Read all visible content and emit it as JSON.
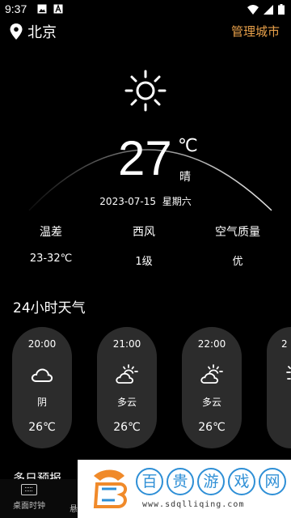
{
  "status_bar": {
    "time": "9:37"
  },
  "header": {
    "city": "北京",
    "manage_label": "管理城市"
  },
  "current": {
    "temperature": "27",
    "unit": "℃",
    "condition": "晴",
    "date": "2023-07-15",
    "weekday": "星期六",
    "icon": "sun-icon"
  },
  "stats": [
    {
      "label": "温差",
      "value": "23-32℃"
    },
    {
      "label": "西风",
      "value": "1级"
    },
    {
      "label": "空气质量",
      "value": "优"
    }
  ],
  "hourly": {
    "title": "24小时天气",
    "items": [
      {
        "time": "20:00",
        "icon": "cloud-icon",
        "condition": "阴",
        "temp": "26℃"
      },
      {
        "time": "21:00",
        "icon": "partly-cloudy-icon",
        "condition": "多云",
        "temp": "26℃"
      },
      {
        "time": "22:00",
        "icon": "partly-cloudy-icon",
        "condition": "多云",
        "temp": "26℃"
      },
      {
        "time": "2",
        "icon": "partly-cloudy-icon",
        "condition": "",
        "temp": ""
      }
    ]
  },
  "multi_day": {
    "title": "多日预报"
  },
  "bottom_nav": {
    "desk_clock": "桌面时钟",
    "next": "悬"
  },
  "watermark": {
    "chars": [
      "百",
      "贵",
      "游",
      "戏",
      "网"
    ],
    "url": "www.sdqlliqing.com"
  },
  "colors": {
    "accent": "#e8a04a",
    "card": "#2c2c2c",
    "watermark": "#2e8fd6"
  }
}
